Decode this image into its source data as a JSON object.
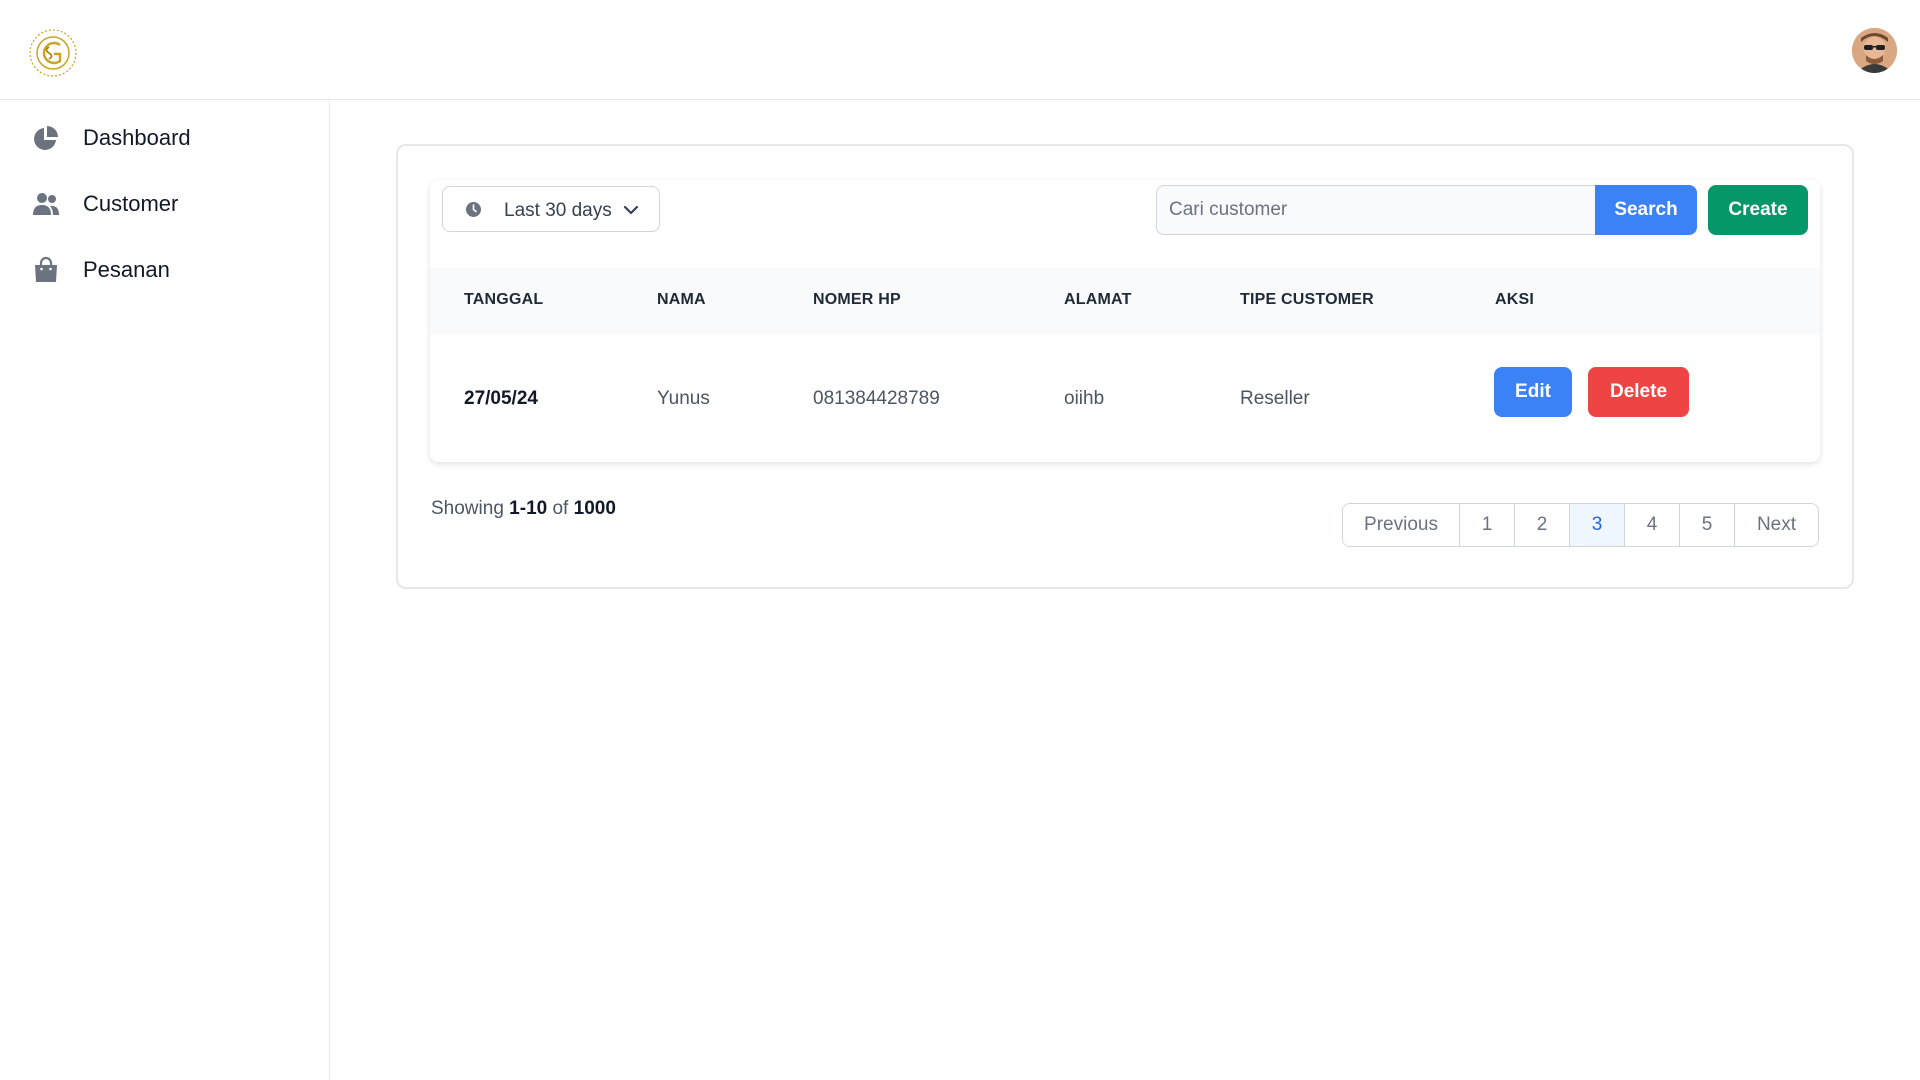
{
  "header": {
    "logo_icon": "gold-monogram-logo",
    "avatar_icon": "user-avatar"
  },
  "sidebar": {
    "items": [
      {
        "label": "Dashboard",
        "icon": "pie-chart-icon"
      },
      {
        "label": "Customer",
        "icon": "users-icon"
      },
      {
        "label": "Pesanan",
        "icon": "shopping-bag-icon"
      }
    ]
  },
  "toolbar": {
    "date_filter_label": "Last 30 days",
    "search_placeholder": "Cari customer",
    "search_label": "Search",
    "create_label": "Create"
  },
  "table": {
    "headers": {
      "tanggal": "TANGGAL",
      "nama": "NAMA",
      "nomer_hp": "NOMER HP",
      "alamat": "ALAMAT",
      "tipe_customer": "TIPE CUSTOMER",
      "aksi": "AKSI"
    },
    "rows": [
      {
        "tanggal": "27/05/24",
        "nama": "Yunus",
        "nomer_hp": "081384428789",
        "alamat": "oiihb",
        "tipe_customer": "Reseller",
        "edit_label": "Edit",
        "delete_label": "Delete"
      }
    ]
  },
  "footer": {
    "showing_prefix": "Showing",
    "showing_range": "1-10",
    "showing_of": "of",
    "showing_total": "1000"
  },
  "pagination": {
    "previous": "Previous",
    "pages": [
      "1",
      "2",
      "3",
      "4",
      "5"
    ],
    "active_page": "3",
    "next": "Next"
  },
  "colors": {
    "primary": "#3b82f6",
    "create": "#059669",
    "danger": "#ef4444",
    "logo_gold": "#c9a227"
  }
}
